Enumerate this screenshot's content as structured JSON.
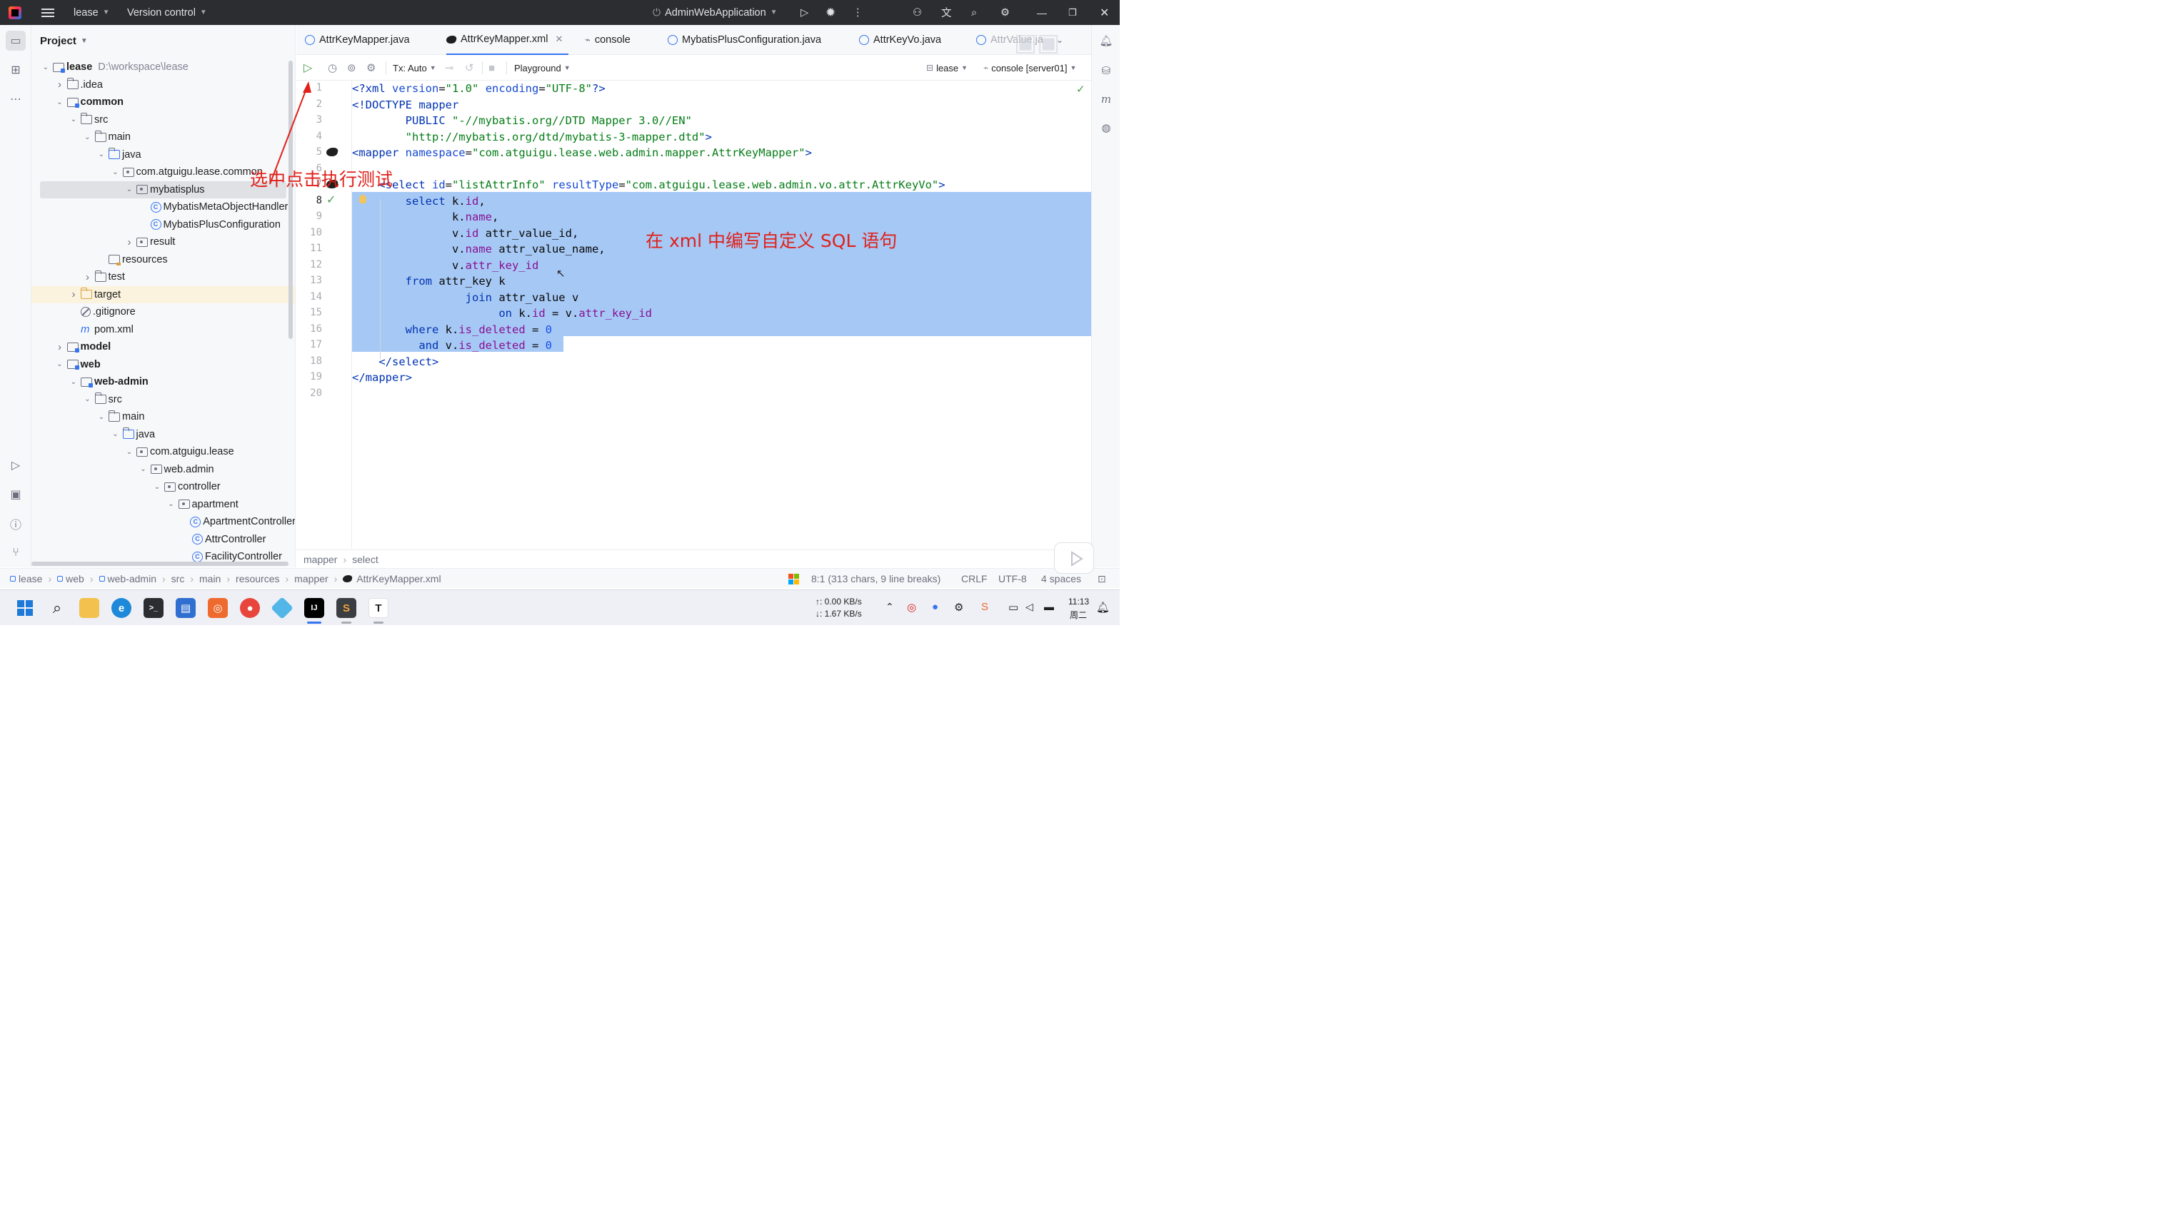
{
  "titlebar": {
    "project_name": "lease",
    "vcs_label": "Version control",
    "run_config": "AdminWebApplication"
  },
  "project_panel": {
    "header": "Project",
    "tree": [
      {
        "label": "lease",
        "hint": "D:\\workspace\\lease",
        "depth": 0,
        "expanded": true,
        "icon": "module",
        "bold": true
      },
      {
        "label": ".idea",
        "depth": 1,
        "expanded": false,
        "icon": "folder"
      },
      {
        "label": "common",
        "depth": 1,
        "expanded": true,
        "icon": "module",
        "bold": true
      },
      {
        "label": "src",
        "depth": 2,
        "expanded": true,
        "icon": "folder"
      },
      {
        "label": "main",
        "depth": 3,
        "expanded": true,
        "icon": "folder"
      },
      {
        "label": "java",
        "depth": 4,
        "expanded": true,
        "icon": "folder-blue"
      },
      {
        "label": "com.atguigu.lease.common",
        "depth": 5,
        "expanded": true,
        "icon": "package"
      },
      {
        "label": "mybatisplus",
        "depth": 6,
        "expanded": true,
        "icon": "package",
        "selected": true
      },
      {
        "label": "MybatisMetaObjectHandler",
        "depth": 7,
        "icon": "class"
      },
      {
        "label": "MybatisPlusConfiguration",
        "depth": 7,
        "icon": "class"
      },
      {
        "label": "result",
        "depth": 6,
        "expanded": false,
        "icon": "package"
      },
      {
        "label": "resources",
        "depth": 4,
        "icon": "resources"
      },
      {
        "label": "test",
        "depth": 3,
        "expanded": false,
        "icon": "folder"
      },
      {
        "label": "target",
        "depth": 2,
        "expanded": false,
        "icon": "target",
        "highlight": true
      },
      {
        "label": ".gitignore",
        "depth": 2,
        "icon": "gitignore"
      },
      {
        "label": "pom.xml",
        "depth": 2,
        "icon": "maven"
      },
      {
        "label": "model",
        "depth": 1,
        "expanded": false,
        "icon": "module",
        "bold": true
      },
      {
        "label": "web",
        "depth": 1,
        "expanded": true,
        "icon": "module",
        "bold": true
      },
      {
        "label": "web-admin",
        "depth": 2,
        "expanded": true,
        "icon": "module",
        "bold": true
      },
      {
        "label": "src",
        "depth": 3,
        "expanded": true,
        "icon": "folder"
      },
      {
        "label": "main",
        "depth": 4,
        "expanded": true,
        "icon": "folder"
      },
      {
        "label": "java",
        "depth": 5,
        "expanded": true,
        "icon": "folder-blue"
      },
      {
        "label": "com.atguigu.lease",
        "depth": 6,
        "expanded": true,
        "icon": "package"
      },
      {
        "label": "web.admin",
        "depth": 7,
        "expanded": true,
        "icon": "package"
      },
      {
        "label": "controller",
        "depth": 8,
        "expanded": true,
        "icon": "package"
      },
      {
        "label": "apartment",
        "depth": 9,
        "expanded": true,
        "icon": "package"
      },
      {
        "label": "ApartmentController",
        "depth": 10,
        "icon": "class"
      },
      {
        "label": "AttrController",
        "depth": 10,
        "icon": "class"
      },
      {
        "label": "FacilityController",
        "depth": 10,
        "icon": "class"
      }
    ]
  },
  "editor_tabs": [
    {
      "label": "AttrKeyMapper.java",
      "icon": "java",
      "active": false
    },
    {
      "label": "AttrKeyMapper.xml",
      "icon": "mybatis-bird",
      "active": true,
      "closable": true
    },
    {
      "label": "console",
      "icon": "console",
      "active": false
    },
    {
      "label": "MybatisPlusConfiguration.java",
      "icon": "java",
      "active": false
    },
    {
      "label": "AttrKeyVo.java",
      "icon": "java",
      "active": false
    },
    {
      "label": "AttrValue.ja",
      "icon": "java",
      "active": false
    }
  ],
  "editor_toolbar": {
    "tx_label": "Tx: Auto",
    "playground_label": "Playground",
    "datasource_label": "lease",
    "console_label": "console [server01]"
  },
  "code_lines": [
    {
      "n": "1",
      "tokens": [
        [
          "tag",
          "<?xml "
        ],
        [
          "attr",
          "version"
        ],
        [
          "pl",
          "="
        ],
        [
          "str",
          "\"1.0\""
        ],
        [
          "pl",
          " "
        ],
        [
          "attr",
          "encoding"
        ],
        [
          "pl",
          "="
        ],
        [
          "str",
          "\"UTF-8\""
        ],
        [
          "tag",
          "?>"
        ]
      ]
    },
    {
      "n": "2",
      "tokens": [
        [
          "tag",
          "<!DOCTYPE "
        ],
        [
          "kw",
          "mapper"
        ]
      ]
    },
    {
      "n": "3",
      "tokens": [
        [
          "pl",
          "        "
        ],
        [
          "kw",
          "PUBLIC "
        ],
        [
          "str",
          "\"-//mybatis.org//DTD Mapper 3.0//EN\""
        ]
      ]
    },
    {
      "n": "4",
      "tokens": [
        [
          "pl",
          "        "
        ],
        [
          "str",
          "\"http://mybatis.org/dtd/mybatis-3-mapper.dtd\""
        ],
        [
          "tag",
          ">"
        ]
      ]
    },
    {
      "n": "5",
      "tokens": [
        [
          "tag",
          "<mapper "
        ],
        [
          "attr",
          "namespace"
        ],
        [
          "pl",
          "="
        ],
        [
          "str",
          "\"com.atguigu.lease.web.admin.mapper.AttrKeyMapper\""
        ],
        [
          "tag",
          ">"
        ]
      ]
    },
    {
      "n": "6",
      "tokens": [
        [
          "pl",
          ""
        ]
      ]
    },
    {
      "n": "7",
      "tokens": [
        [
          "pl",
          "    "
        ],
        [
          "tag",
          "<select "
        ],
        [
          "attr",
          "id"
        ],
        [
          "pl",
          "="
        ],
        [
          "str",
          "\"listAttrInfo\""
        ],
        [
          "pl",
          " "
        ],
        [
          "attr",
          "resultType"
        ],
        [
          "pl",
          "="
        ],
        [
          "str",
          "\"com.atguigu.lease.web.admin.vo.attr.AttrKeyVo\""
        ],
        [
          "tag",
          ">"
        ]
      ]
    },
    {
      "n": "8",
      "tokens": [
        [
          "pl",
          "        "
        ],
        [
          "kw",
          "select "
        ],
        [
          "pl",
          "k."
        ],
        [
          "fld",
          "id"
        ],
        [
          "pl",
          ","
        ]
      ]
    },
    {
      "n": "9",
      "tokens": [
        [
          "pl",
          "               k."
        ],
        [
          "fld",
          "name"
        ],
        [
          "pl",
          ","
        ]
      ]
    },
    {
      "n": "10",
      "tokens": [
        [
          "pl",
          "               v."
        ],
        [
          "fld",
          "id"
        ],
        [
          "pl",
          " attr_value_id,"
        ]
      ]
    },
    {
      "n": "11",
      "tokens": [
        [
          "pl",
          "               v."
        ],
        [
          "fld",
          "name"
        ],
        [
          "pl",
          " attr_value_name,"
        ]
      ]
    },
    {
      "n": "12",
      "tokens": [
        [
          "pl",
          "               v."
        ],
        [
          "fld",
          "attr_key_id"
        ]
      ]
    },
    {
      "n": "13",
      "tokens": [
        [
          "pl",
          "        "
        ],
        [
          "kw",
          "from "
        ],
        [
          "pl",
          "attr_key k"
        ]
      ]
    },
    {
      "n": "14",
      "tokens": [
        [
          "pl",
          "                 "
        ],
        [
          "kw",
          "join "
        ],
        [
          "pl",
          "attr_value v"
        ]
      ]
    },
    {
      "n": "15",
      "tokens": [
        [
          "pl",
          "                      "
        ],
        [
          "kw",
          "on "
        ],
        [
          "pl",
          "k."
        ],
        [
          "fld",
          "id"
        ],
        [
          "pl",
          " = v."
        ],
        [
          "fld",
          "attr_key_id"
        ]
      ]
    },
    {
      "n": "16",
      "tokens": [
        [
          "pl",
          "        "
        ],
        [
          "kw",
          "where "
        ],
        [
          "pl",
          "k."
        ],
        [
          "fld",
          "is_deleted"
        ],
        [
          "pl",
          " = "
        ],
        [
          "num",
          "0"
        ]
      ]
    },
    {
      "n": "17",
      "tokens": [
        [
          "pl",
          "          "
        ],
        [
          "kw",
          "and "
        ],
        [
          "pl",
          "v."
        ],
        [
          "fld",
          "is_deleted"
        ],
        [
          "pl",
          " = "
        ],
        [
          "num",
          "0"
        ]
      ]
    },
    {
      "n": "18",
      "tokens": [
        [
          "pl",
          "    "
        ],
        [
          "tag",
          "</select>"
        ]
      ]
    },
    {
      "n": "19",
      "tokens": [
        [
          "tag",
          "</mapper>"
        ]
      ]
    },
    {
      "n": "20",
      "tokens": [
        [
          "pl",
          ""
        ]
      ]
    }
  ],
  "annotations": {
    "click_hint": "选中点击执行测试",
    "sql_hint": "在 xml 中编写自定义 SQL 语句"
  },
  "code_breadcrumb": [
    "mapper",
    "select"
  ],
  "status_breadcrumb": [
    "lease",
    "web",
    "web-admin",
    "src",
    "main",
    "resources",
    "mapper",
    "AttrKeyMapper.xml"
  ],
  "status_right": {
    "selection": "8:1 (313 chars, 9 line breaks)",
    "line_sep": "CRLF",
    "encoding": "UTF-8",
    "indent": "4 spaces"
  },
  "taskbar": {
    "net_up": "↑: 0.00 KB/s",
    "net_down": "↓: 1.67 KB/s",
    "time": "11:13",
    "day": "周二"
  },
  "colors": {
    "selection": "#a6c8f4",
    "accent": "#3574f0",
    "annotation": "#e0201b",
    "titlebar": "#2b2d30"
  }
}
